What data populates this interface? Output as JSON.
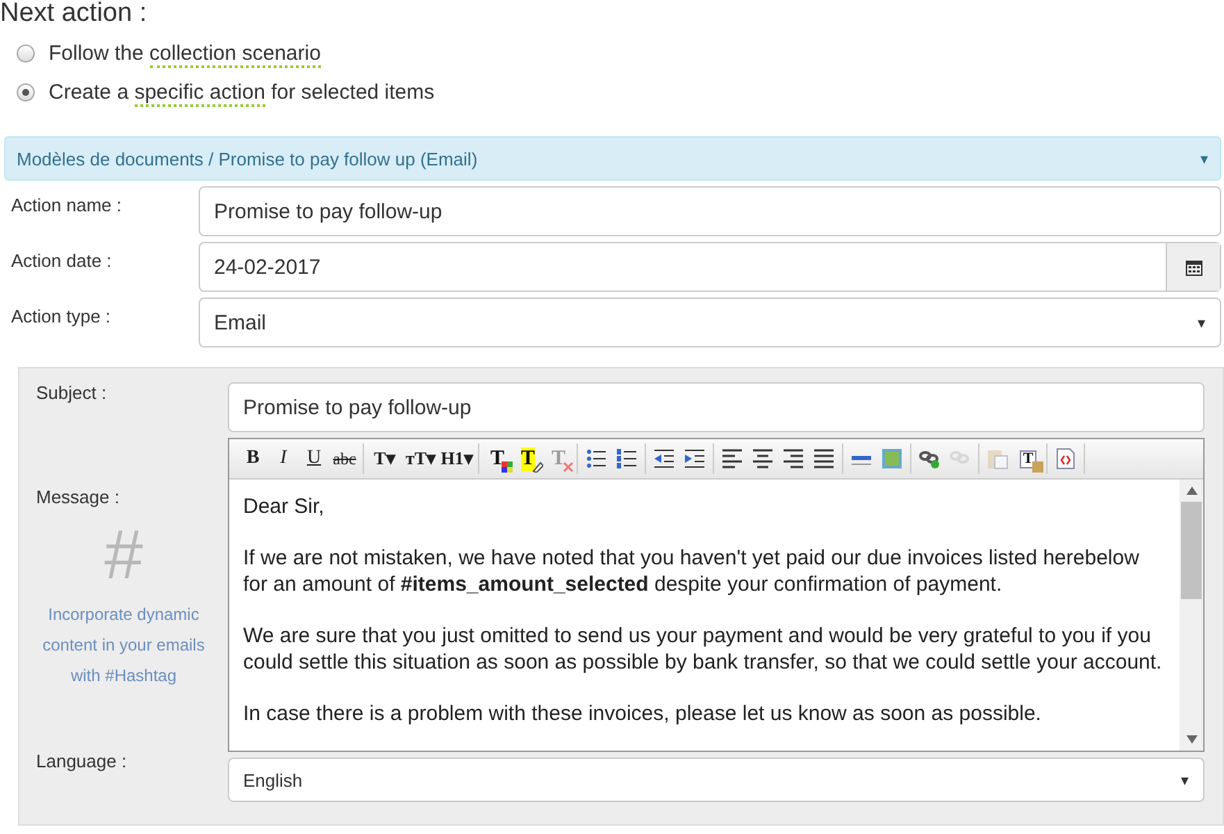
{
  "heading": "Next action :",
  "options": [
    {
      "before": "Follow the ",
      "link": "collection scenario",
      "selected": false
    },
    {
      "before": "Create a ",
      "link": "specific action",
      "after": " for selected items",
      "selected": true
    }
  ],
  "template_bar": {
    "label": "Modèles de documents / Promise to pay follow up (Email)",
    "caret": "▾"
  },
  "fields": [
    {
      "kind": "text",
      "label": "Action name :",
      "value": "Promise to pay follow-up"
    },
    {
      "kind": "date",
      "label": "Action date :",
      "value": "24-02-2017"
    },
    {
      "kind": "select",
      "label": "Action type :",
      "value": "Email",
      "caret": "▾"
    }
  ],
  "email": {
    "subject_label": "Subject :",
    "subject": "Promise to pay follow-up",
    "message_label": "Message :",
    "hashtag_mark": "#",
    "hashtag_hint": "Incorporate dynamic content in your emails with #Hashtag",
    "toolbar": [
      [
        {
          "kind": "bold",
          "glyph": "B",
          "disabled": false
        },
        {
          "kind": "italic",
          "glyph": "I",
          "disabled": false
        },
        {
          "kind": "underline",
          "glyph": "U",
          "disabled": false
        },
        {
          "kind": "strike",
          "glyph": "abc",
          "disabled": false
        }
      ],
      [
        {
          "kind": "menu",
          "glyph": "T▾",
          "disabled": false
        },
        {
          "kind": "menu",
          "glyph": "тT▾",
          "disabled": false
        },
        {
          "kind": "menu",
          "glyph": "H1▾",
          "disabled": false
        }
      ],
      [
        {
          "kind": "text-color",
          "glyph": "T",
          "disabled": false
        },
        {
          "kind": "highlight",
          "glyph": "T",
          "disabled": false
        },
        {
          "kind": "clear-format",
          "glyph": "T",
          "disabled": true
        }
      ],
      [
        {
          "kind": "bullet-list",
          "disabled": false
        },
        {
          "kind": "numbered-list",
          "disabled": false
        }
      ],
      [
        {
          "kind": "outdent",
          "disabled": false
        },
        {
          "kind": "indent",
          "disabled": false
        }
      ],
      [
        {
          "kind": "align-left",
          "disabled": false
        },
        {
          "kind": "align-center",
          "disabled": false
        },
        {
          "kind": "align-right",
          "disabled": false
        },
        {
          "kind": "justify",
          "disabled": false
        }
      ],
      [
        {
          "kind": "rule",
          "disabled": false
        },
        {
          "kind": "image",
          "disabled": false
        }
      ],
      [
        {
          "kind": "link",
          "disabled": false
        },
        {
          "kind": "unlink",
          "disabled": true
        }
      ],
      [
        {
          "kind": "paste",
          "disabled": true
        },
        {
          "kind": "paste-text",
          "glyph": "T",
          "disabled": false
        }
      ],
      [
        {
          "kind": "source",
          "disabled": false
        }
      ]
    ],
    "body": [
      "Dear Sir,",
      "If we are not mistaken, we have noted that you haven't yet paid our due invoices listed herebelow for an amount of **#items_amount_selected** despite your confirmation of payment.",
      "We are sure that you just omitted to send us your payment and would be very grateful to you if you could settle this situation as soon as possible by bank transfer, so that we could settle your account.",
      "In case there is a problem with these invoices, please let us know as soon as possible."
    ],
    "language_label": "Language :",
    "language": "English",
    "language_caret": "▾"
  }
}
